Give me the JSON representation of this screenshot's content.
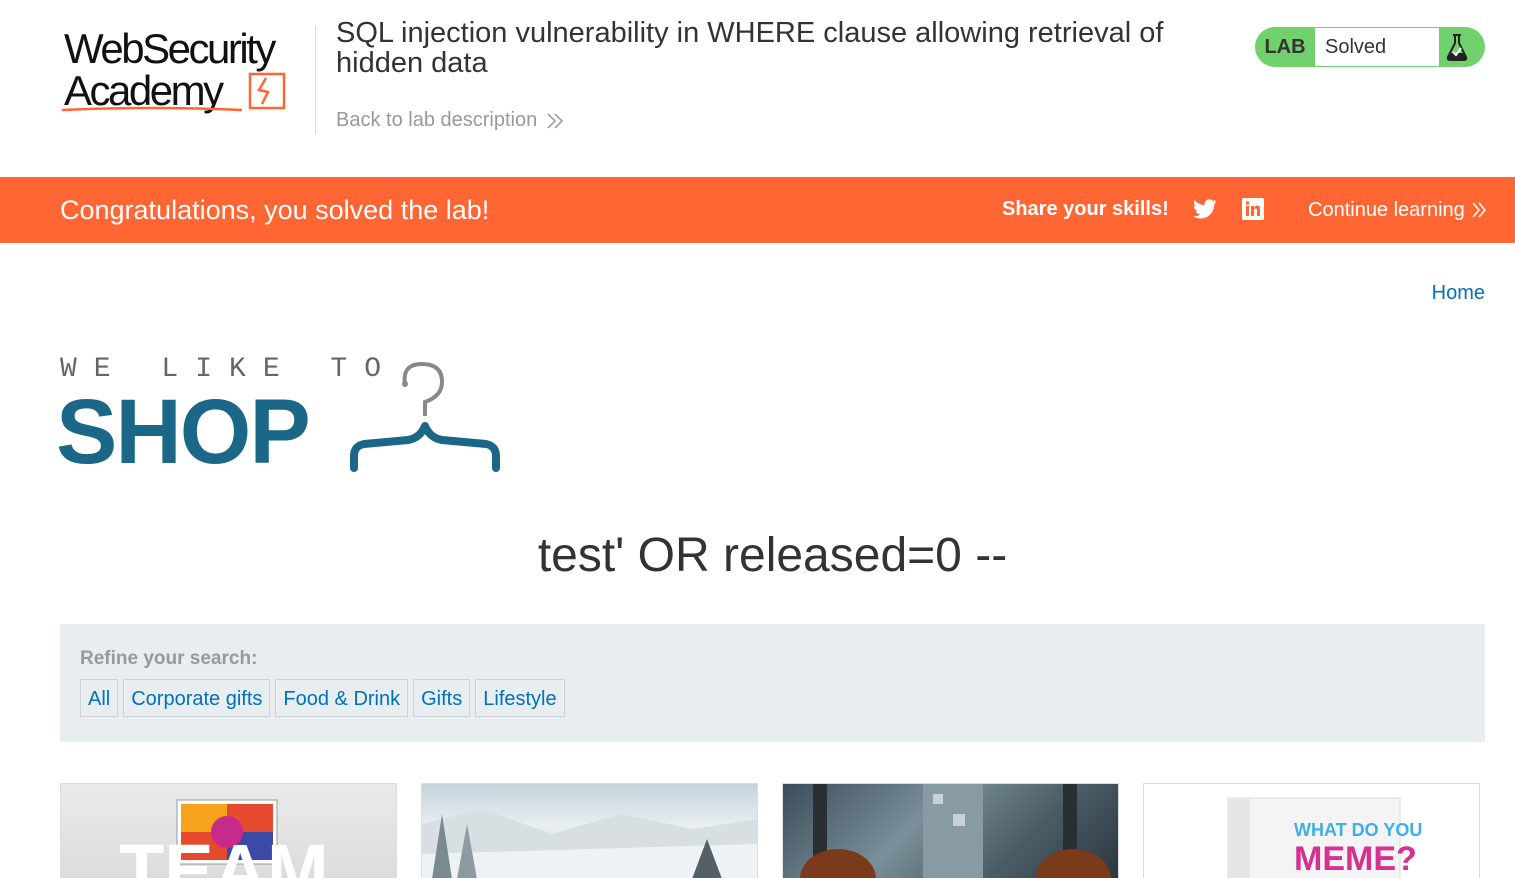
{
  "header": {
    "logo_line1": "WebSecurity",
    "logo_line2": "Academy",
    "lab_title": "SQL injection vulnerability in WHERE clause allowing retrieval of hidden data",
    "back_link": "Back to lab description",
    "lab_badge": {
      "label": "LAB",
      "status": "Solved"
    }
  },
  "banner": {
    "message": "Congratulations, you solved the lab!",
    "share_label": "Share your skills!",
    "continue_label": "Continue learning",
    "icons": [
      "twitter-icon",
      "linkedin-icon"
    ],
    "color": "#ff6633"
  },
  "nav": {
    "home": "Home"
  },
  "shop_logo": {
    "tagline": "WE LIKE TO",
    "word": "SHOP",
    "color": "#1b6787"
  },
  "search": {
    "heading": "test' OR released=0 --"
  },
  "filters": {
    "label": "Refine your search:",
    "items": [
      "All",
      "Corporate gifts",
      "Food & Drink",
      "Gifts",
      "Lifestyle"
    ]
  },
  "products": {
    "p1_overlay_text": "TEAM",
    "p4_box_text_1": "WHAT DO YOU",
    "p4_box_text_2": "MEME?"
  },
  "colors": {
    "accent_green": "#70d16d",
    "link_blue": "#0071bc",
    "filter_bg": "#e8edf0"
  }
}
